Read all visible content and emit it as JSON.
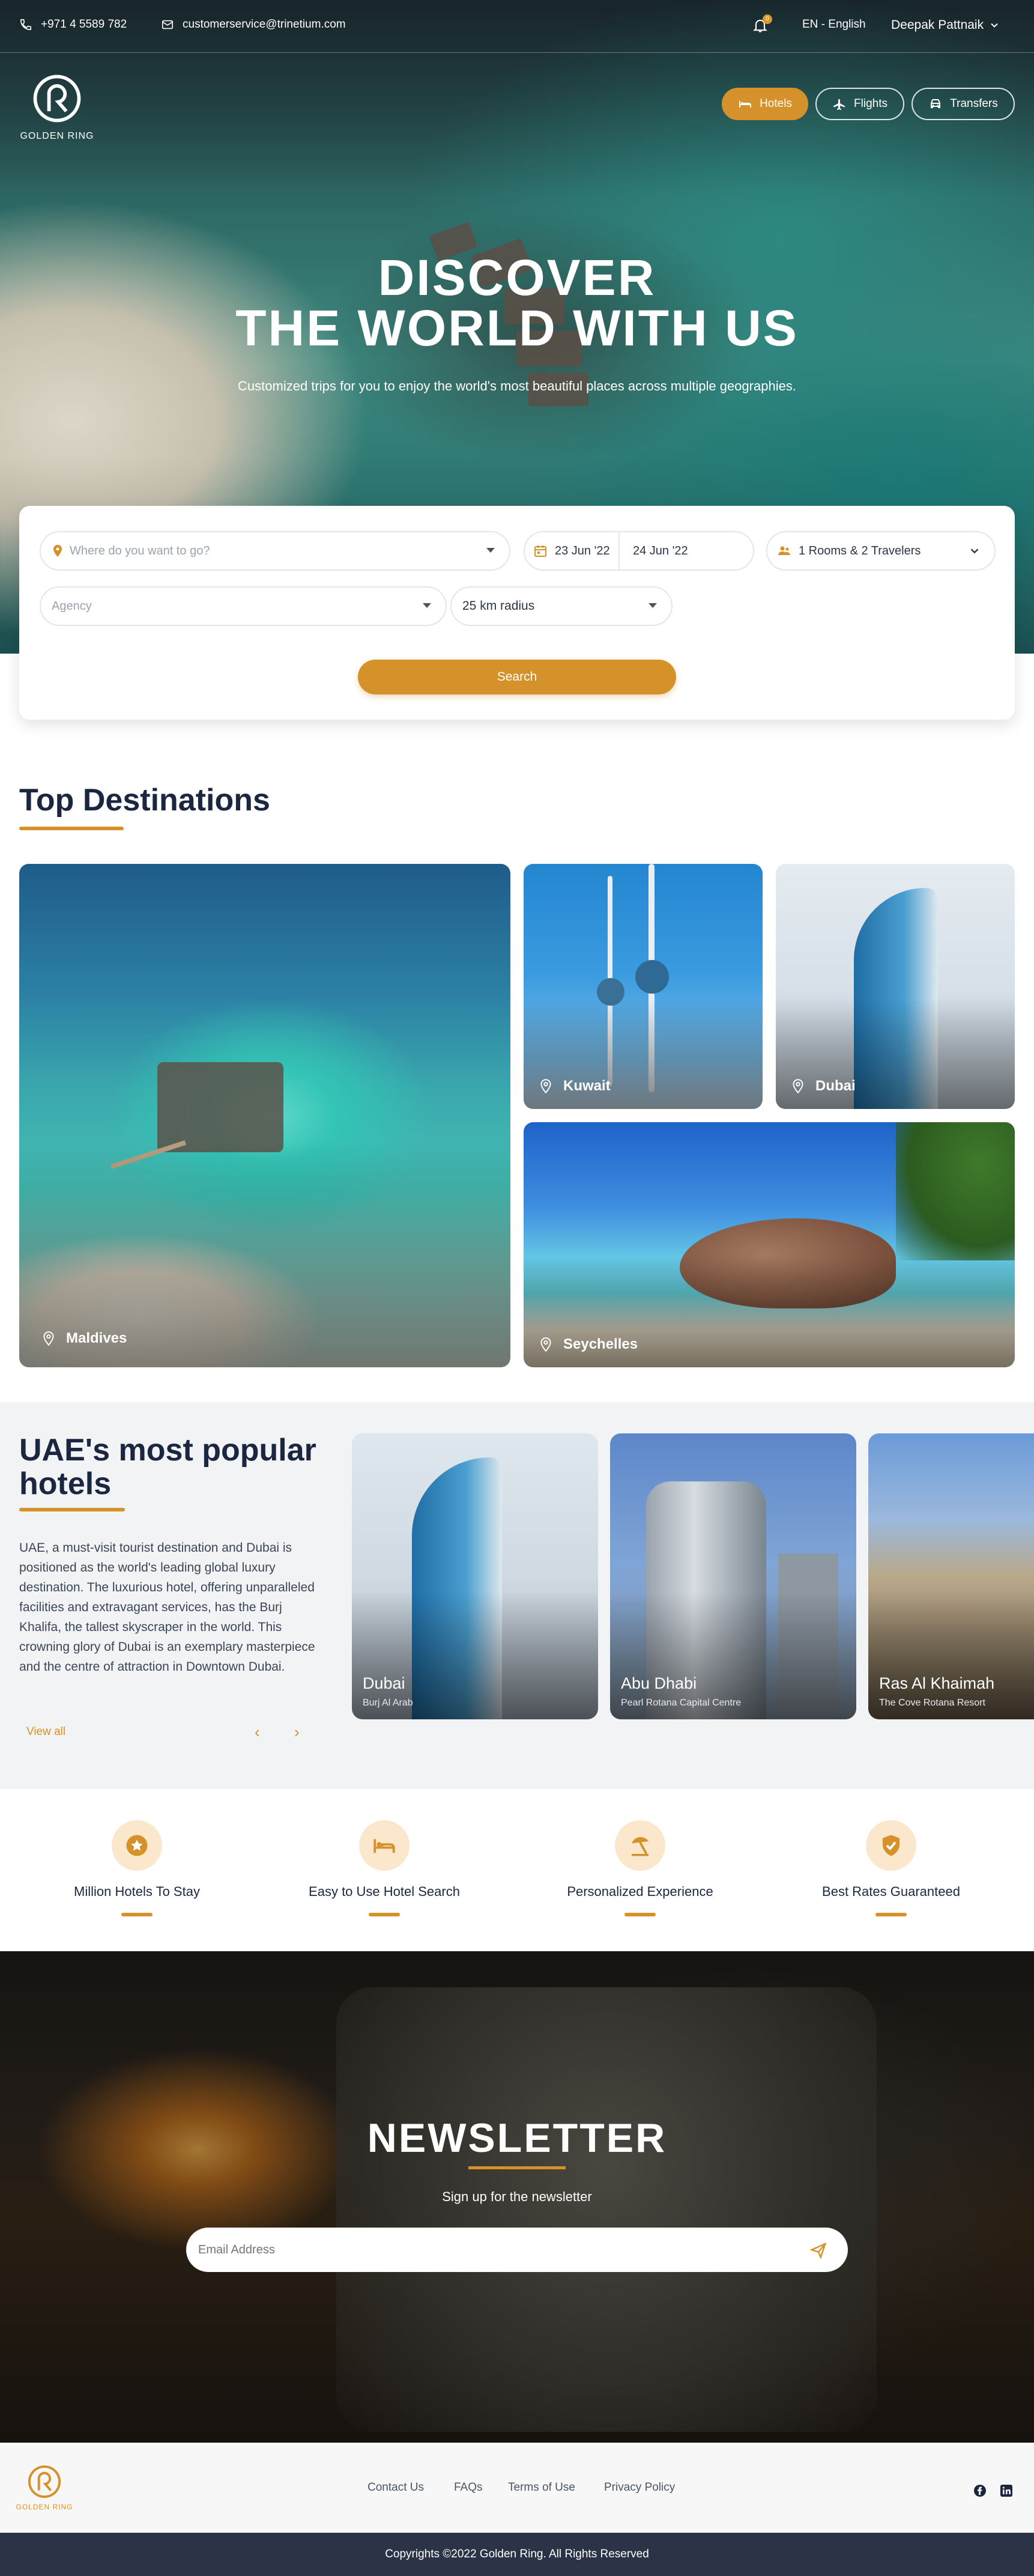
{
  "topbar": {
    "phone": "+971 4 5589 782",
    "email": "customerservice@trinetium.com",
    "notification_count": "0",
    "language": "EN -  English",
    "user_name": "Deepak Pattnaik"
  },
  "brand": {
    "logo_text": "GOLDEN RING"
  },
  "modes": [
    {
      "label": "Hotels",
      "icon": "bed-icon",
      "active": true
    },
    {
      "label": "Flights",
      "icon": "plane-icon",
      "active": false
    },
    {
      "label": "Transfers",
      "icon": "car-icon",
      "active": false
    }
  ],
  "hero": {
    "title_line1": "DISCOVER",
    "title_line2": "THE WORLD WITH US",
    "subtitle": "Customized trips for you to enjoy the world's most beautiful places across multiple geographies."
  },
  "search": {
    "destination_placeholder": "Where do you want to go?",
    "checkin": "23 Jun '22",
    "checkout": "24 Jun '22",
    "guests": "1 Rooms & 2 Travelers",
    "agency_placeholder": "Agency",
    "radius": "25 km radius",
    "button": "Search"
  },
  "top_destinations": {
    "title": "Top Destinations",
    "items": [
      "Maldives",
      "Kuwait",
      "Dubai",
      "Seychelles"
    ]
  },
  "uae_hotels": {
    "title": "UAE's most popular hotels",
    "description": "UAE, a must-visit tourist destination and Dubai is positioned as the world's leading global luxury destination. The luxurious hotel, offering unparalleled facilities and extravagant services, has the Burj Khalifa, the tallest skyscraper in the world. This crowning glory of Dubai is an exemplary masterpiece and the centre of attraction in Downtown Dubai.",
    "view_all": "View all",
    "prev": "‹",
    "next": "›",
    "hotels": [
      {
        "city": "Dubai",
        "name": "Burj Al Arab"
      },
      {
        "city": "Abu Dhabi",
        "name": "Pearl Rotana Capital Centre"
      },
      {
        "city": "Ras Al Khaimah",
        "name": "The Cove Rotana Resort"
      }
    ]
  },
  "features": [
    {
      "label": "Million Hotels To Stay",
      "icon": "star-icon"
    },
    {
      "label": "Easy to Use Hotel Search",
      "icon": "bed-icon"
    },
    {
      "label": "Personalized Experience",
      "icon": "beach-umbrella-icon"
    },
    {
      "label": "Best Rates Guaranteed",
      "icon": "shield-check-icon"
    }
  ],
  "newsletter": {
    "title": "NEWSLETTER",
    "subtitle": "Sign up for the newsletter",
    "email_placeholder": "Email Address"
  },
  "footer": {
    "links": [
      "Contact Us",
      "FAQs",
      "Terms of Use",
      "Privacy Policy"
    ],
    "copyright": "Copyrights ©2022 Golden Ring. All Rights Reserved"
  },
  "colors": {
    "accent": "#d6922a",
    "dark": "#1b2740",
    "footer_bar": "#2b3446"
  }
}
